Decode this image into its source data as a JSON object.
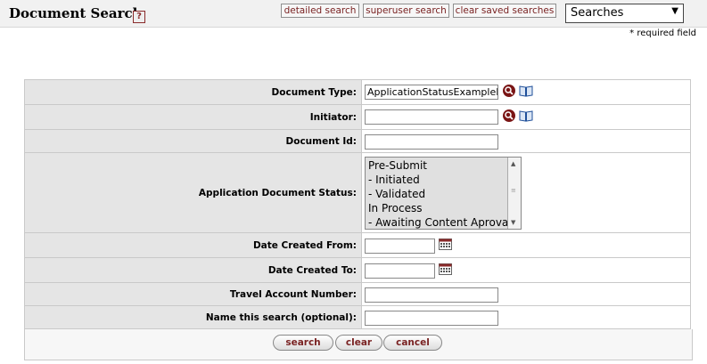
{
  "header": {
    "title": "Document Search",
    "help_icon": "help-icon",
    "links": {
      "detailed": "detailed search",
      "superuser": "superuser search",
      "clear_saved": "clear saved searches"
    },
    "searches_select": "Searches"
  },
  "required_note": "* required field",
  "form": {
    "document_type": {
      "label": "Document Type:",
      "value": "ApplicationStatusExampleDocument"
    },
    "initiator": {
      "label": "Initiator:",
      "value": ""
    },
    "document_id": {
      "label": "Document Id:",
      "value": ""
    },
    "app_doc_status": {
      "label": "Application Document Status:",
      "options": [
        "Pre-Submit",
        "- Initiated",
        "- Validated",
        "In Process",
        "- Awaiting Content Aproval"
      ]
    },
    "date_from": {
      "label": "Date Created From:",
      "value": ""
    },
    "date_to": {
      "label": "Date Created To:",
      "value": ""
    },
    "travel_account": {
      "label": "Travel Account Number:",
      "value": ""
    },
    "search_name": {
      "label": "Name this search (optional):",
      "value": ""
    }
  },
  "buttons": {
    "search": "search",
    "clear": "clear",
    "cancel": "cancel"
  },
  "icons": {
    "lookup": "magnifier-lookup-icon",
    "inquiry": "book-inquiry-icon",
    "calendar": "calendar-icon"
  },
  "colors": {
    "accent": "#7a2323",
    "label_bg": "#e5e5e5"
  }
}
